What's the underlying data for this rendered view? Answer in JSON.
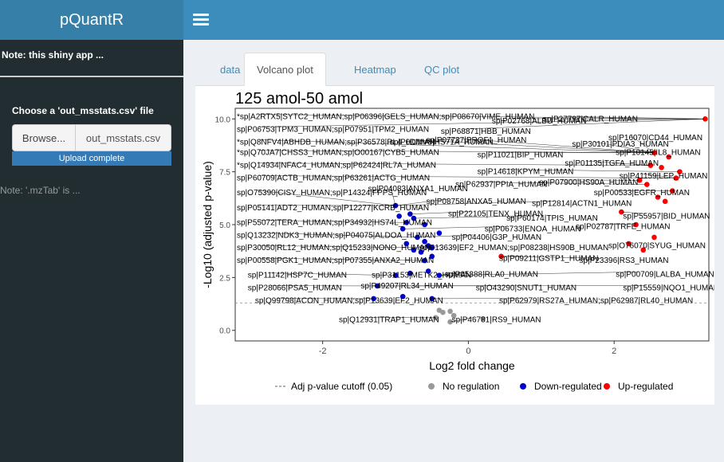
{
  "app": {
    "title": "pQuantR"
  },
  "sidebar": {
    "note": "Note: this shiny app ...",
    "file_label": "Choose a 'out_msstats.csv' file",
    "browse_label": "Browse...",
    "file_name": "out_msstats.csv",
    "upload_status": "Upload complete",
    "note2": "Note: '.mzTab' is ..."
  },
  "tabs": [
    {
      "label": "data",
      "active": false
    },
    {
      "label": "Volcano plot",
      "active": true
    },
    {
      "label": "Heatmap",
      "active": false
    },
    {
      "label": "QC plot",
      "active": false
    }
  ],
  "colors": {
    "no_regulation": "#999999",
    "down": "#0000cd",
    "up": "#ff0000",
    "brand": "#3c8dbc"
  },
  "chart_data": {
    "type": "scatter",
    "title": "125 amol-50 amol",
    "xlabel": "Log2 fold change",
    "ylabel": "-Log10 (adjusted p-value)",
    "xlim": [
      -3.2,
      3.3
    ],
    "ylim": [
      -0.5,
      10.5
    ],
    "x_ticks": [
      -2,
      0,
      2
    ],
    "y_ticks": [
      0.0,
      2.5,
      5.0,
      7.5,
      10.0
    ],
    "y_tick_labels": [
      "0.0",
      "2.5",
      "5.0",
      "7.5",
      "10.0"
    ],
    "cutoff": 1.3,
    "legend": [
      {
        "label": "Adj p-value cutoff (0.05)",
        "kind": "line"
      },
      {
        "label": "No regulation",
        "kind": "no"
      },
      {
        "label": "Down-regulated",
        "kind": "down"
      },
      {
        "label": "Up-regulated",
        "kind": "up"
      }
    ],
    "points": [
      {
        "x": -0.25,
        "y": 0.9,
        "group": "no"
      },
      {
        "x": -0.35,
        "y": 0.85,
        "group": "no"
      },
      {
        "x": -0.4,
        "y": 0.95,
        "group": "no"
      },
      {
        "x": -0.2,
        "y": 0.7,
        "group": "no"
      },
      {
        "x": -0.25,
        "y": 0.4,
        "group": "no"
      },
      {
        "x": 0.2,
        "y": 0.55,
        "group": "no"
      },
      {
        "x": -0.45,
        "y": 0.6,
        "group": "no"
      },
      {
        "x": -1.3,
        "y": 1.5,
        "group": "down"
      },
      {
        "x": -0.9,
        "y": 1.6,
        "group": "down"
      },
      {
        "x": -0.5,
        "y": 1.5,
        "group": "down"
      },
      {
        "x": -1.25,
        "y": 2.1,
        "group": "down"
      },
      {
        "x": -1.0,
        "y": 2.6,
        "group": "down"
      },
      {
        "x": -0.8,
        "y": 2.7,
        "group": "down"
      },
      {
        "x": -0.55,
        "y": 2.8,
        "group": "down"
      },
      {
        "x": -0.4,
        "y": 2.6,
        "group": "down"
      },
      {
        "x": -0.6,
        "y": 3.3,
        "group": "down"
      },
      {
        "x": -0.5,
        "y": 3.5,
        "group": "down"
      },
      {
        "x": -0.65,
        "y": 3.7,
        "group": "down"
      },
      {
        "x": -0.75,
        "y": 3.8,
        "group": "down"
      },
      {
        "x": -0.55,
        "y": 4.0,
        "group": "down"
      },
      {
        "x": -0.85,
        "y": 4.1,
        "group": "down"
      },
      {
        "x": -0.7,
        "y": 4.4,
        "group": "down"
      },
      {
        "x": -0.6,
        "y": 4.2,
        "group": "down"
      },
      {
        "x": -0.9,
        "y": 4.8,
        "group": "down"
      },
      {
        "x": -0.85,
        "y": 5.1,
        "group": "down"
      },
      {
        "x": -0.8,
        "y": 5.5,
        "group": "down"
      },
      {
        "x": -0.75,
        "y": 5.3,
        "group": "down"
      },
      {
        "x": -0.95,
        "y": 5.4,
        "group": "down"
      },
      {
        "x": -0.6,
        "y": 5.0,
        "group": "down"
      },
      {
        "x": -0.4,
        "y": 4.6,
        "group": "down"
      },
      {
        "x": -1.0,
        "y": 5.9,
        "group": "down"
      },
      {
        "x": -0.5,
        "y": 3.9,
        "group": "down"
      },
      {
        "x": 0.45,
        "y": 3.5,
        "group": "up"
      },
      {
        "x": 2.55,
        "y": 8.4,
        "group": "up"
      },
      {
        "x": 2.75,
        "y": 8.2,
        "group": "up"
      },
      {
        "x": 2.6,
        "y": 6.3,
        "group": "up"
      },
      {
        "x": 2.7,
        "y": 6.1,
        "group": "up"
      },
      {
        "x": 2.8,
        "y": 6.6,
        "group": "up"
      },
      {
        "x": 2.85,
        "y": 7.2,
        "group": "up"
      },
      {
        "x": 2.9,
        "y": 7.5,
        "group": "up"
      },
      {
        "x": 2.65,
        "y": 7.7,
        "group": "up"
      },
      {
        "x": 2.5,
        "y": 7.8,
        "group": "up"
      },
      {
        "x": 2.35,
        "y": 7.1,
        "group": "up"
      },
      {
        "x": 2.45,
        "y": 6.9,
        "group": "up"
      },
      {
        "x": 2.3,
        "y": 5.0,
        "group": "up"
      },
      {
        "x": 2.2,
        "y": 4.1,
        "group": "up"
      },
      {
        "x": 2.4,
        "y": 3.8,
        "group": "up"
      },
      {
        "x": 2.55,
        "y": 4.4,
        "group": "up"
      },
      {
        "x": 2.1,
        "y": 5.6,
        "group": "up"
      },
      {
        "x": 3.25,
        "y": 10.0,
        "group": "up"
      }
    ],
    "labels": [
      {
        "text": "*sp|A2RTX5|SYTC2_HUMAN;sp|P06396|GELS_HUMAN;sp|P08670|VIME_HUMAN",
        "x": -3.2,
        "y": 10.1
      },
      {
        "text": "sp|P06753|TPM3_HUMAN;sp|P07951|TPM2_HUMAN",
        "x": -3.2,
        "y": 9.5
      },
      {
        "text": "*sp|Q8NFV4|ABHDB_HUMAN;sp|P36578|RL4_HUMAN",
        "x": -3.2,
        "y": 8.9
      },
      {
        "text": "*sp|Q70JA7|CHSS3_HUMAN;sp|O00167|CYB5_HUMAN",
        "x": -3.2,
        "y": 8.4
      },
      {
        "text": "*sp|Q14934|NFAC4_HUMAN;sp|P62424|RL7A_HUMAN",
        "x": -3.2,
        "y": 7.8
      },
      {
        "text": "sp|P60709|ACTB_HUMAN;sp|P63261|ACTG_HUMAN",
        "x": -3.2,
        "y": 7.2
      },
      {
        "text": "sp|O75390|CISY_HUMAN;sp|P14324|FPPS_HUMAN",
        "x": -3.2,
        "y": 6.5
      },
      {
        "text": "sp|P05141|ADT2_HUMAN;sp|P12277|KCRB_HUMAN",
        "x": -3.2,
        "y": 5.8
      },
      {
        "text": "sp|P55072|TERA_HUMAN;sp|P34932|HS74L_HUMAN",
        "x": -3.2,
        "y": 5.1
      },
      {
        "text": "sp|Q13232|NDK3_HUMAN;sp|P04075|ALDOA_HUMAN",
        "x": -3.2,
        "y": 4.5
      },
      {
        "text": "sp|P30050|RL12_HUMAN;sp|Q15233|NONO_HUMAN",
        "x": -3.2,
        "y": 3.9
      },
      {
        "text": "sp|P00558|PGK1_HUMAN;sp|P07355|ANXA2_HUMAN",
        "x": -3.2,
        "y": 3.3
      },
      {
        "text": "sp|P11142|HSP7C_HUMAN",
        "x": -3.05,
        "y": 2.6
      },
      {
        "text": "sp|P31153|METK2_HUMAN",
        "x": -1.35,
        "y": 2.6
      },
      {
        "text": "sp|P28066|PSA5_HUMAN",
        "x": -3.05,
        "y": 2.0
      },
      {
        "text": "sp|P49207|RL34_HUMAN",
        "x": -1.5,
        "y": 2.1
      },
      {
        "text": "sp|Q99798|ACON_HUMAN;sp|P13639|EF2_HUMAN",
        "x": -2.95,
        "y": 1.4
      },
      {
        "text": "sp|Q12931|TRAP1_HUMAN",
        "x": -1.8,
        "y": 0.5
      },
      {
        "text": "sp|P46781|RS9_HUMAN",
        "x": -0.25,
        "y": 0.5
      },
      {
        "text": "sp|O43290|SNUT1_HUMAN",
        "x": 0.08,
        "y": 2.0
      },
      {
        "text": "sp|P05388|RLA0_HUMAN",
        "x": -0.35,
        "y": 2.65
      },
      {
        "text": "sp|P62979|RS27A_HUMAN;sp|P62987|RL40_HUMAN",
        "x": 0.4,
        "y": 1.4
      },
      {
        "text": "sp|P15559|NQO1_HUMAN",
        "x": 2.1,
        "y": 2.0
      },
      {
        "text": "sp|P00709|LALBA_HUMAN",
        "x": 2.0,
        "y": 2.65
      },
      {
        "text": "sp|P23396|RS3_HUMAN",
        "x": 1.5,
        "y": 3.3
      },
      {
        "text": "sp|O76070|SYUG_HUMAN",
        "x": 1.9,
        "y": 4.0
      },
      {
        "text": "sp|P02787|TRFE_HUMAN",
        "x": 1.45,
        "y": 4.9
      },
      {
        "text": "sp|P55957|BID_HUMAN",
        "x": 2.1,
        "y": 5.4
      },
      {
        "text": "sp|P41159|LEP_HUMAN",
        "x": 2.05,
        "y": 7.3
      },
      {
        "text": "sp|P10145|IL8_HUMAN",
        "x": 2.0,
        "y": 8.4
      },
      {
        "text": "sp|P01135|TGFA_HUMAN",
        "x": 1.3,
        "y": 7.9
      },
      {
        "text": "sp|P16070|CD44_HUMAN",
        "x": 1.9,
        "y": 9.1
      },
      {
        "text": "sp|P00533|EGFR_HUMAN",
        "x": 1.7,
        "y": 6.5
      },
      {
        "text": "sp|P12814|ACTN1_HUMAN",
        "x": 0.85,
        "y": 6.0
      },
      {
        "text": "sp|P22105|TENX_HUMAN",
        "x": -0.3,
        "y": 5.5
      },
      {
        "text": "sp|P08758|ANXA5_HUMAN",
        "x": -0.6,
        "y": 6.1
      },
      {
        "text": "sp|P04083|ANXA1_HUMAN",
        "x": -1.4,
        "y": 6.7
      },
      {
        "text": "sp|P14618|KPYM_HUMAN",
        "x": 0.1,
        "y": 7.5
      },
      {
        "text": "sp|P02768|ALBU_HUMAN",
        "x": 0.3,
        "y": 9.9
      },
      {
        "text": "sp|P68871|HBB_HUMAN",
        "x": -0.4,
        "y": 9.4
      },
      {
        "text": "sp|P0DMV8|HS71A_HUMAN",
        "x": -1.1,
        "y": 8.9
      },
      {
        "text": "sp|P11021|BIP_HUMAN",
        "x": 0.1,
        "y": 8.3
      },
      {
        "text": "sp|P04406|G3P_HUMAN",
        "x": -0.25,
        "y": 4.4
      },
      {
        "text": "sp|P09211|GSTP1_HUMAN",
        "x": 0.4,
        "y": 3.4
      },
      {
        "text": "sp|P06733|ENOA_HUMAN",
        "x": 0.2,
        "y": 4.8
      },
      {
        "text": "sp|P27797|CALR_HUMAN",
        "x": 1.0,
        "y": 10.0
      },
      {
        "text": "sp|P07737|PROF1_HUMAN",
        "x": -0.6,
        "y": 9.0
      },
      {
        "text": "sp|P62937|PPIA_HUMAN",
        "x": -0.2,
        "y": 6.9
      },
      {
        "text": "sp|P30101|PDIA3_HUMAN",
        "x": 1.4,
        "y": 8.8
      },
      {
        "text": "sp|P13639|EF2_HUMAN;sp|P08238|HS90B_HUMAN",
        "x": -0.7,
        "y": 3.9
      },
      {
        "text": "sp|P60174|TPIS_HUMAN",
        "x": 0.5,
        "y": 5.3
      },
      {
        "text": "sp|P07900|HS90A_HUMAN",
        "x": 0.95,
        "y": 7.0
      }
    ]
  }
}
